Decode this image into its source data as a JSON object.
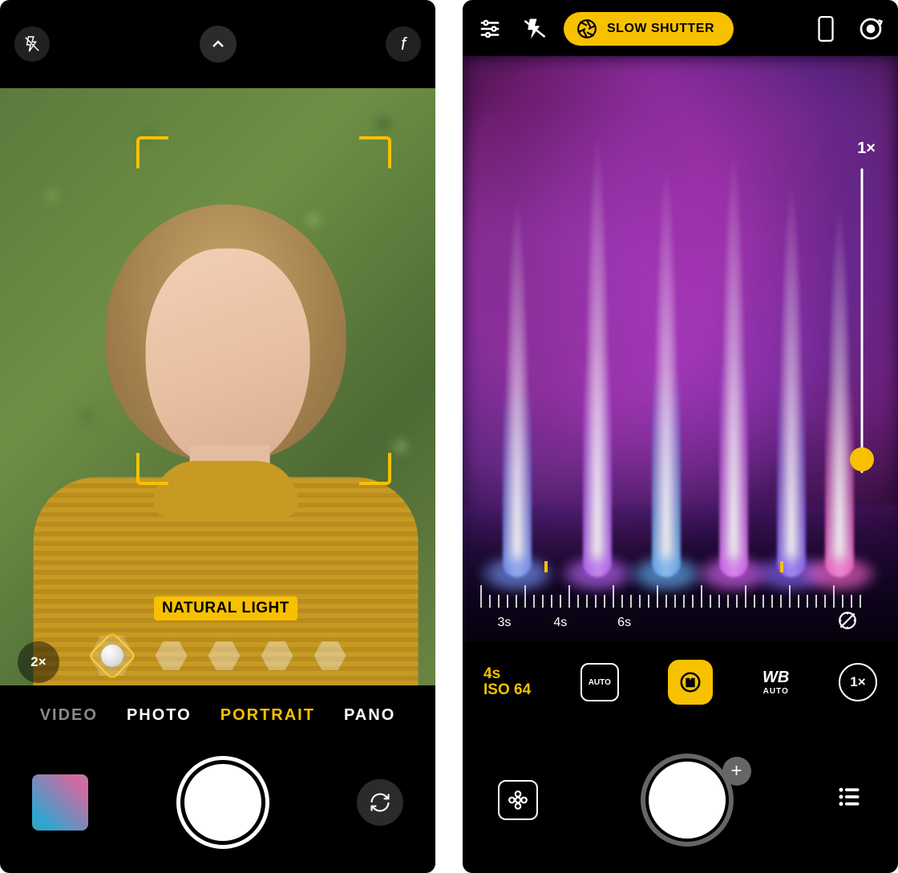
{
  "left": {
    "top": {
      "flash": "flash-off-icon",
      "chevron": "chevron-up-icon",
      "f": "f"
    },
    "badge": "NATURAL LIGHT",
    "zoom": "2×",
    "modes": [
      "VIDEO",
      "PHOTO",
      "PORTRAIT",
      "PANO"
    ],
    "selectedModeIndex": 2
  },
  "right": {
    "pill": "SLOW SHUTTER",
    "zoomLabel": "1×",
    "scale": {
      "ticks": [
        "3s",
        "4s",
        "6s"
      ],
      "indicatorPositions": [
        16,
        75
      ]
    },
    "readout": {
      "shutter": "4s",
      "iso": "ISO 64"
    },
    "auto": "AUTO",
    "wb": {
      "main": "WB",
      "sub": "AUTO"
    },
    "zoomBtn": "1×",
    "plus": "+"
  }
}
